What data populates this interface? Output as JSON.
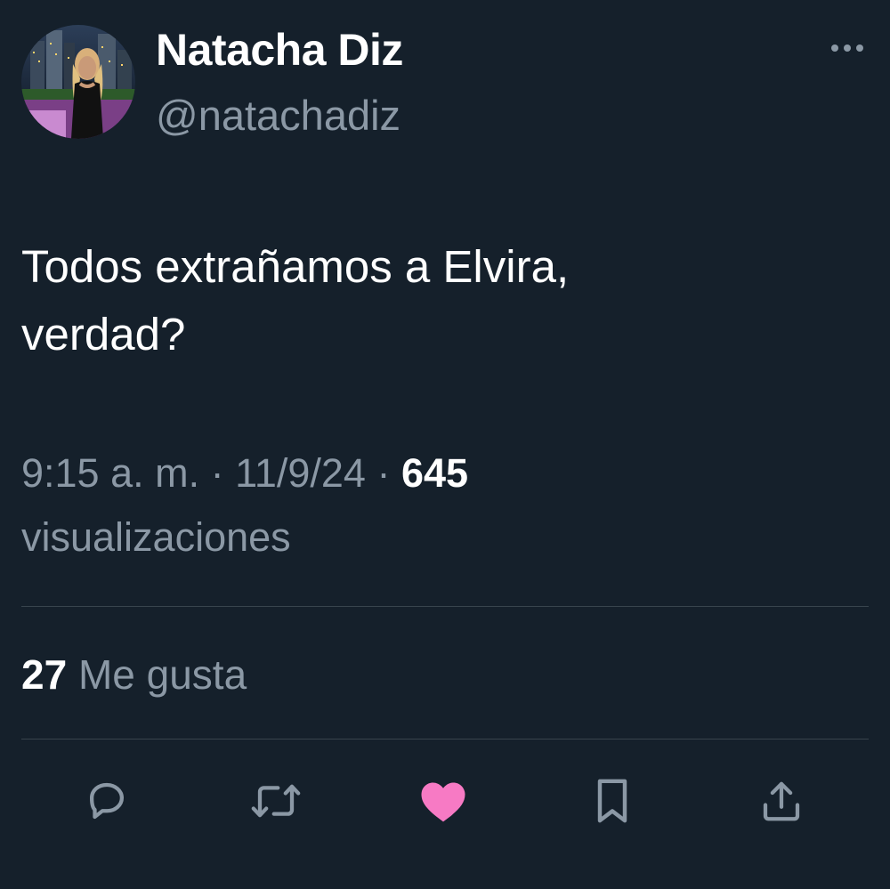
{
  "author": {
    "display_name": "Natacha Diz",
    "handle": "@natachadiz",
    "avatar_icon": "profile-photo"
  },
  "tweet": {
    "text": "Todos extrañamos a Elvira,\nverdad?",
    "time": "9:15 a. m.",
    "separator": "·",
    "date": "11/9/24",
    "views_count": "645",
    "views_label": "visualizaciones"
  },
  "engagement": {
    "likes_count": "27",
    "likes_label": "Me gusta"
  },
  "actions": {
    "more_icon": "more-icon",
    "reply_icon": "reply-icon",
    "retweet_icon": "retweet-icon",
    "like_icon": "heart-icon",
    "bookmark_icon": "bookmark-icon",
    "share_icon": "share-icon"
  },
  "colors": {
    "background": "#15202b",
    "primary_text": "#ffffff",
    "secondary_text": "#8b98a5",
    "divider": "#38444d",
    "liked": "#f91880"
  }
}
